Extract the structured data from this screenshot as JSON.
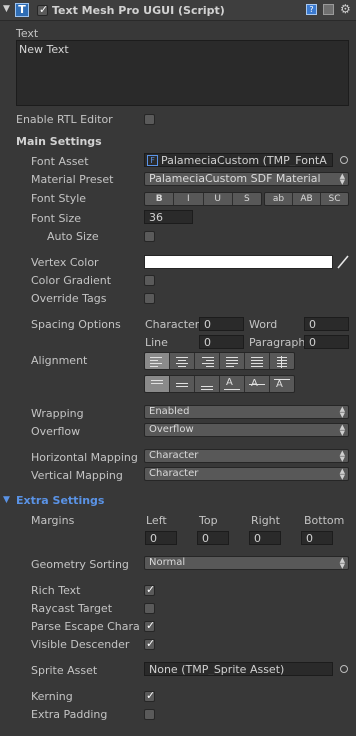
{
  "header": {
    "title": "Text Mesh Pro UGUI (Script)",
    "enabled": true
  },
  "text": {
    "label": "Text",
    "value": "New Text"
  },
  "rtl": {
    "label": "Enable RTL Editor",
    "checked": false
  },
  "main": {
    "title": "Main Settings",
    "font_asset": {
      "label": "Font Asset",
      "value": "PalameciaCustom (TMP_FontA"
    },
    "material_preset": {
      "label": "Material Preset",
      "value": "PalameciaCustom SDF Material"
    },
    "font_style": {
      "label": "Font Style",
      "buttons_a": [
        "B",
        "I",
        "U",
        "S"
      ],
      "buttons_b": [
        "ab",
        "AB",
        "SC"
      ]
    },
    "font_size": {
      "label": "Font Size",
      "value": "36"
    },
    "auto_size": {
      "label": "Auto Size",
      "checked": false
    },
    "vertex_color": {
      "label": "Vertex Color",
      "color": "#ffffff"
    },
    "color_gradient": {
      "label": "Color Gradient",
      "checked": false
    },
    "override_tags": {
      "label": "Override Tags",
      "checked": false
    },
    "spacing": {
      "label": "Spacing Options",
      "character": {
        "label": "Character",
        "value": "0"
      },
      "word": {
        "label": "Word",
        "value": "0"
      },
      "line": {
        "label": "Line",
        "value": "0"
      },
      "paragraph": {
        "label": "Paragraph",
        "value": "0"
      }
    },
    "alignment": {
      "label": "Alignment"
    },
    "wrapping": {
      "label": "Wrapping",
      "value": "Enabled"
    },
    "overflow": {
      "label": "Overflow",
      "value": "Overflow"
    },
    "horizontal_mapping": {
      "label": "Horizontal Mapping",
      "value": "Character"
    },
    "vertical_mapping": {
      "label": "Vertical Mapping",
      "value": "Character"
    }
  },
  "extra": {
    "title": "Extra Settings",
    "margins": {
      "label": "Margins",
      "left": {
        "label": "Left",
        "value": "0"
      },
      "top": {
        "label": "Top",
        "value": "0"
      },
      "right": {
        "label": "Right",
        "value": "0"
      },
      "bottom": {
        "label": "Bottom",
        "value": "0"
      }
    },
    "geometry_sorting": {
      "label": "Geometry Sorting",
      "value": "Normal"
    },
    "rich_text": {
      "label": "Rich Text",
      "checked": true
    },
    "raycast_target": {
      "label": "Raycast Target",
      "checked": false
    },
    "parse_escape": {
      "label": "Parse Escape Chara",
      "checked": true
    },
    "visible_descender": {
      "label": "Visible Descender",
      "checked": true
    },
    "sprite_asset": {
      "label": "Sprite Asset",
      "value": "None (TMP_Sprite Asset)"
    },
    "kerning": {
      "label": "Kerning",
      "checked": true
    },
    "extra_padding": {
      "label": "Extra Padding",
      "checked": false
    }
  },
  "colors": {
    "background": "#383838",
    "accent": "#5a93e6",
    "field": "#2a2a2a"
  }
}
